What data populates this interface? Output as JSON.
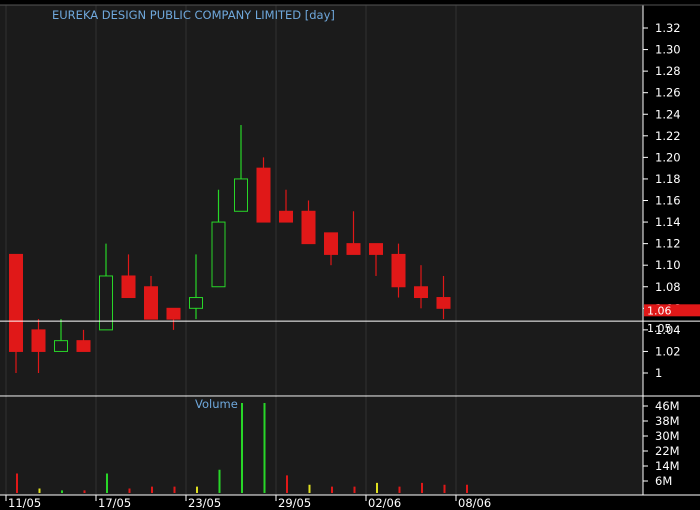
{
  "title": "EUREKA DESIGN PUBLIC COMPANY LIMITED [day]",
  "colors": {
    "background": "#000000",
    "panel": "#1b1b1b",
    "down": "#e01818",
    "up": "#28d628",
    "vol_neutral": "#e0e020",
    "grid": "#303030",
    "price_box": "#e01818",
    "ref_line": "#ffffff",
    "title_text": "#6fa8dc"
  },
  "current_price": {
    "label": "1.06",
    "value": 1.06
  },
  "ref_line": {
    "label": "1.05",
    "value": 1.05
  },
  "volume_title": "Volume",
  "chart_data": [
    {
      "type": "candlestick",
      "title": "EUREKA DESIGN PUBLIC COMPANY LIMITED [day]",
      "ylim": [
        0.99,
        1.33
      ],
      "yticks": [
        "1.32",
        "1.30",
        "1.28",
        "1.26",
        "1.24",
        "1.22",
        "1.20",
        "1.18",
        "1.16",
        "1.14",
        "1.12",
        "1.10",
        "1.08",
        "1.06",
        "1.04",
        "1.02",
        "1"
      ],
      "ytick_values": [
        1.32,
        1.3,
        1.28,
        1.26,
        1.24,
        1.22,
        1.2,
        1.18,
        1.16,
        1.14,
        1.12,
        1.1,
        1.08,
        1.06,
        1.04,
        1.02,
        1.0
      ],
      "xtick_labels": [
        "11/05",
        "17/05",
        "23/05",
        "29/05",
        "02/06",
        "08/06"
      ],
      "xtick_index": [
        0,
        4,
        8,
        12,
        16,
        20
      ],
      "candles": [
        {
          "open": 1.11,
          "high": 1.11,
          "low": 1.0,
          "close": 1.02
        },
        {
          "open": 1.04,
          "high": 1.05,
          "low": 1.0,
          "close": 1.02
        },
        {
          "open": 1.02,
          "high": 1.05,
          "low": 1.02,
          "close": 1.03
        },
        {
          "open": 1.03,
          "high": 1.04,
          "low": 1.02,
          "close": 1.02
        },
        {
          "open": 1.04,
          "high": 1.12,
          "low": 1.04,
          "close": 1.09
        },
        {
          "open": 1.09,
          "high": 1.11,
          "low": 1.07,
          "close": 1.07
        },
        {
          "open": 1.08,
          "high": 1.09,
          "low": 1.05,
          "close": 1.05
        },
        {
          "open": 1.06,
          "high": 1.06,
          "low": 1.04,
          "close": 1.05
        },
        {
          "open": 1.06,
          "high": 1.11,
          "low": 1.05,
          "close": 1.07
        },
        {
          "open": 1.08,
          "high": 1.17,
          "low": 1.08,
          "close": 1.14
        },
        {
          "open": 1.15,
          "high": 1.23,
          "low": 1.15,
          "close": 1.18
        },
        {
          "open": 1.19,
          "high": 1.2,
          "low": 1.14,
          "close": 1.14
        },
        {
          "open": 1.15,
          "high": 1.17,
          "low": 1.14,
          "close": 1.14
        },
        {
          "open": 1.15,
          "high": 1.16,
          "low": 1.12,
          "close": 1.12
        },
        {
          "open": 1.13,
          "high": 1.13,
          "low": 1.1,
          "close": 1.11
        },
        {
          "open": 1.12,
          "high": 1.15,
          "low": 1.11,
          "close": 1.11
        },
        {
          "open": 1.12,
          "high": 1.12,
          "low": 1.09,
          "close": 1.11
        },
        {
          "open": 1.11,
          "high": 1.12,
          "low": 1.07,
          "close": 1.08
        },
        {
          "open": 1.08,
          "high": 1.1,
          "low": 1.06,
          "close": 1.07
        },
        {
          "open": 1.07,
          "high": 1.09,
          "low": 1.05,
          "close": 1.06
        }
      ]
    },
    {
      "type": "bar",
      "title": "Volume",
      "ylim": [
        0,
        50
      ],
      "ytick_labels": [
        "46M",
        "38M",
        "30M",
        "22M",
        "14M",
        "6M"
      ],
      "ytick_values": [
        46,
        38,
        30,
        22,
        14,
        6
      ],
      "values": [
        10,
        2,
        1,
        1,
        10,
        2,
        3,
        3,
        3,
        12,
        60,
        60,
        9,
        4,
        3,
        3,
        5,
        3,
        5,
        4,
        4
      ],
      "bar_colors": [
        "down",
        "vol_neutral",
        "up",
        "down",
        "up",
        "down",
        "down",
        "down",
        "vol_neutral",
        "up",
        "up",
        "up",
        "down",
        "vol_neutral",
        "down",
        "down",
        "vol_neutral",
        "down",
        "down",
        "down",
        "down"
      ]
    }
  ]
}
